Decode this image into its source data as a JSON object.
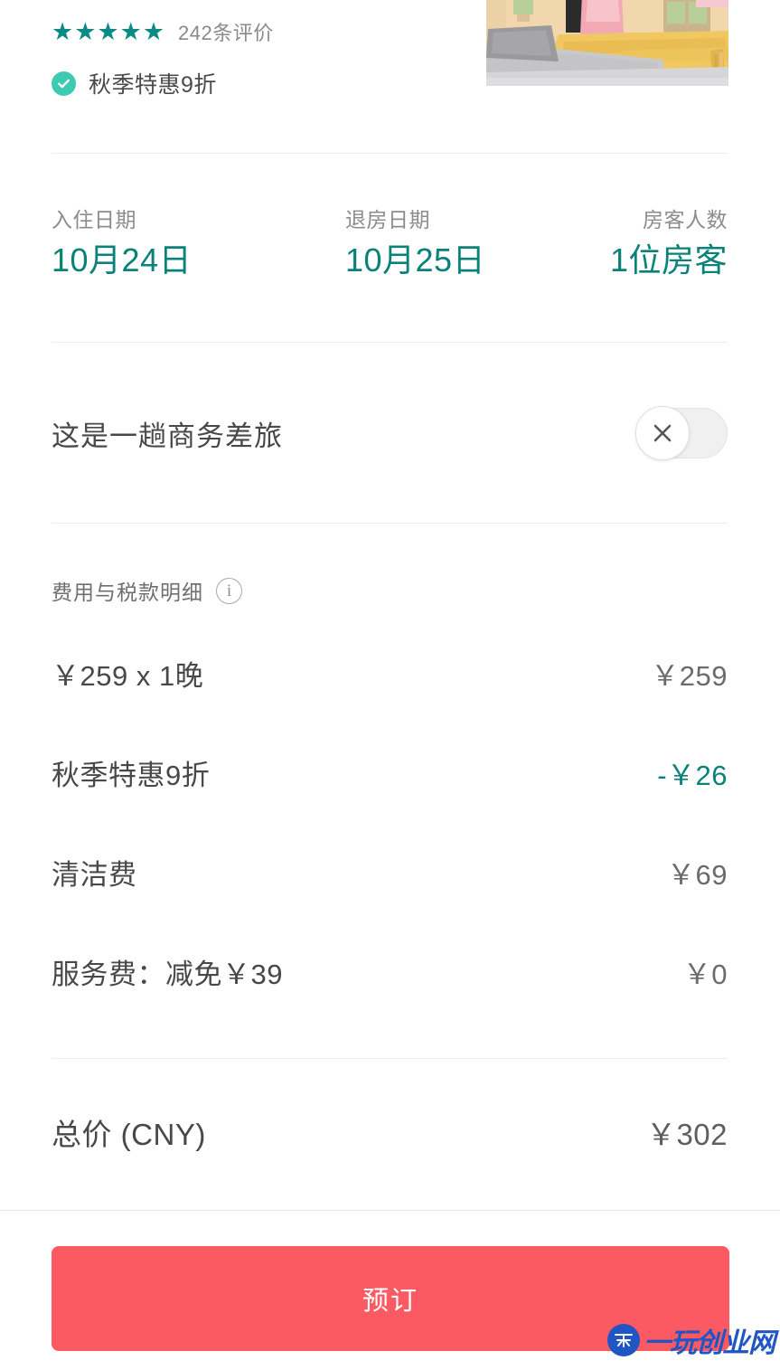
{
  "listing": {
    "stars": "★★★★★",
    "star_count": 5,
    "review_count_label": "242条评价",
    "promo_badge_icon": "check-circle-icon",
    "promo_label": "秋季特惠9折",
    "thumbnail_alt": "房间照片"
  },
  "trip": {
    "checkin": {
      "label": "入住日期",
      "value": "10月24日"
    },
    "checkout": {
      "label": "退房日期",
      "value": "10月25日"
    },
    "guests": {
      "label": "房客人数",
      "value": "1位房客"
    }
  },
  "business_trip": {
    "label": "这是一趟商务差旅",
    "toggle_state": "off",
    "toggle_glyph": "✕"
  },
  "fees": {
    "header": "费用与税款明细",
    "info_icon": "i",
    "items": [
      {
        "name": "￥259 x 1晚",
        "amount": "￥259",
        "is_discount": false
      },
      {
        "name": "秋季特惠9折",
        "amount": "-￥26",
        "is_discount": true
      },
      {
        "name": "清洁费",
        "amount": "￥69",
        "is_discount": false
      },
      {
        "name": "服务费：减免￥39",
        "amount": "￥0",
        "is_discount": false
      }
    ],
    "total": {
      "name": "总价 (CNY)",
      "amount": "￥302"
    }
  },
  "footer": {
    "book_button": "预订"
  },
  "watermark": {
    "text": "一玩创业网"
  },
  "colors": {
    "teal": "#0a8279",
    "star_teal": "#0a8a84",
    "badge_green": "#3ecab2",
    "cta_red": "#fb5a63",
    "text_dark": "#484848",
    "text_muted": "#8a8a8a",
    "divider": "#ededed",
    "watermark_blue": "#1f56c4"
  }
}
